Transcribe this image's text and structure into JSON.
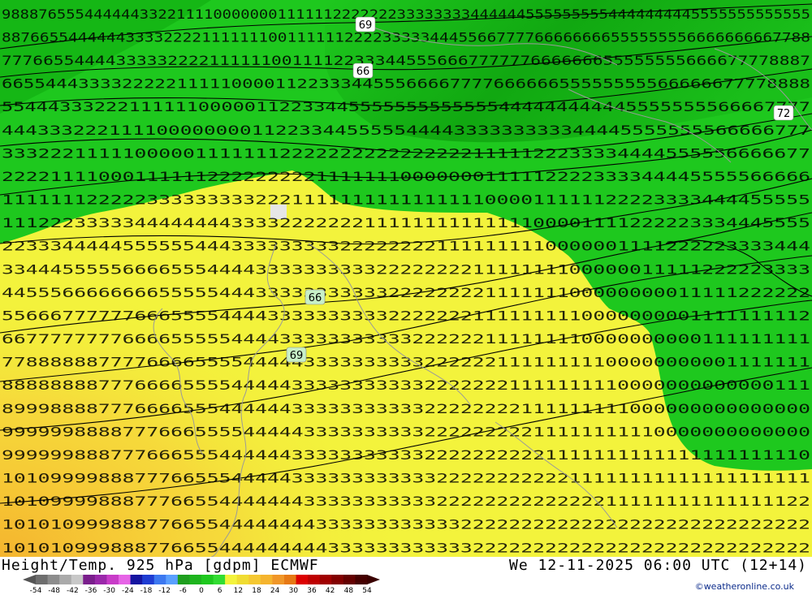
{
  "map": {
    "contour_labels": [
      "69",
      "66",
      "72",
      "66",
      "69"
    ],
    "colors": {
      "green_field": "#1ec81e",
      "dark_green": "#0ba10b",
      "yellow_field": "#f3f33c",
      "orange_field": "#f5b42e",
      "contour": "#000000",
      "coast": "#9a9a9a"
    },
    "digit_rows": [
      "9888765554444443322111100000001111112222222333333334444445555555554444444445555555555555",
      "8876655444444333322221111111001111112222333334445566777766666666555555556666666667788",
      "777665544443333322221111110011112233344555666777777666666655555555666677778887",
      "66554443333222221111100001122333445556666777766666655555555566666677778888",
      "5544433322211111100000112233445555555555555444444444445555555566667777",
      "44433322211110000000011223344555554444333333333344445555555566666777",
      "3332221111100000111111122222222222222221111122233334444555556666677",
      "2222111100011111122222222211111110000000111112222333344445555566666",
      "1111111222223333333332221111111111111111000011111122223333444455555",
      "1112223333344444444333322222221111111111111100001111222223334445555",
      "2233344444555555444333333333222222221111111110000001111222223333444",
      "3344455555666655544443333333333222222221111111100000011111222223333",
      "4455566666666555554443333333333322222222111111100000000011111222222",
      "5566677777766655554444333333333322222221111111110000000001111111112",
      "6677777777666655555444433333333333222222111111110000000000111111111",
      "7788888877776666555544444333333333322222211111111100000000001111111",
      "8888888877766665555444443333333333322222221111111110000000000000111",
      "8999888877766665554444443333333333322222222111111111000000000000000",
      "9999998888777666555544444333333333322222222211111111110000000000000",
      "9999998887776665554444443333333333322222222221111111111111111111110",
      "1010999988877766555444443333333333332222222222211111111111111111111",
      "1010999988877766554444444333333333332222222222222211111111111111122",
      "1010109998887766554444444433333333333322222222222222222222222222222",
      "1010109998887766554444444443333333333332222222222222222222222222222"
    ]
  },
  "footer": {
    "title_left": "Height/Temp. 925 hPa [gdpm] ECMWF",
    "title_right": "We 12-11-2025 06:00 UTC (12+14)",
    "credit": "©weatheronline.co.uk",
    "scale_ticks": [
      "-54",
      "-48",
      "-42",
      "-36",
      "-30",
      "-24",
      "-18",
      "-12",
      "-6",
      "0",
      "6",
      "12",
      "18",
      "24",
      "30",
      "36",
      "42",
      "48",
      "54"
    ],
    "scale_colors": [
      "#6e6e6e",
      "#8c8c8c",
      "#aaaaaa",
      "#c8c8c8",
      "#7a1e8c",
      "#9a28aa",
      "#c83cc8",
      "#e664e6",
      "#1414a0",
      "#1e3cd2",
      "#3c78f0",
      "#5aa0ff",
      "#1e9e1e",
      "#1eb41e",
      "#1ec81e",
      "#32dc32",
      "#f3f33c",
      "#f0dc32",
      "#f5c832",
      "#f5b42e",
      "#f09628",
      "#e67814",
      "#dc0000",
      "#be0000",
      "#a00000",
      "#820000",
      "#640000",
      "#460000"
    ]
  }
}
